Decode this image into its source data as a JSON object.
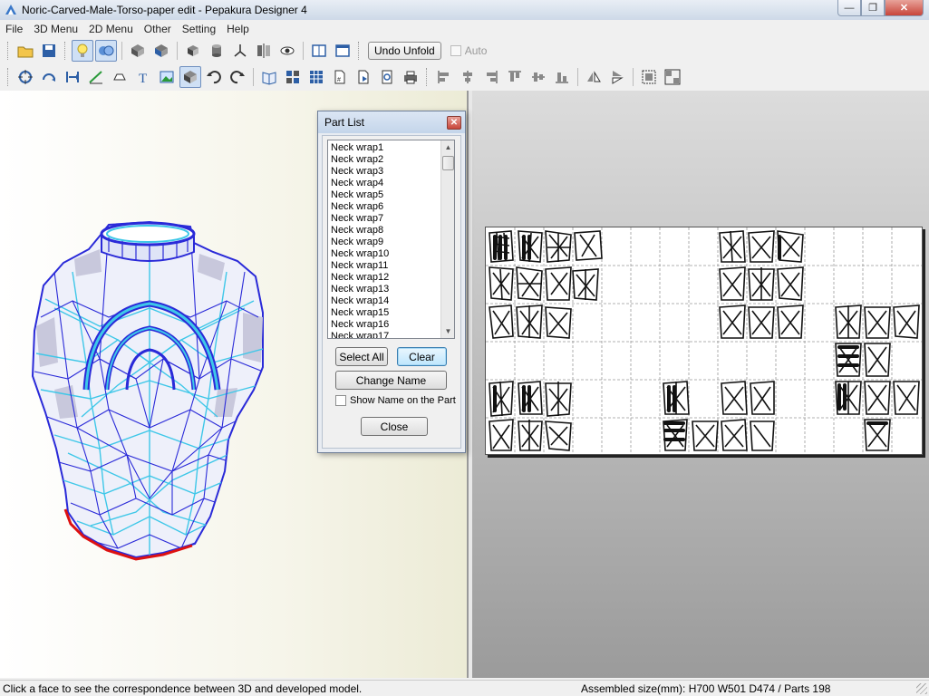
{
  "window": {
    "title": "Noric-Carved-Male-Torso-paper edit - Pepakura Designer 4",
    "controls": {
      "minimize": "—",
      "maximize": "❐",
      "close": "✕"
    }
  },
  "menu": [
    "File",
    "3D Menu",
    "2D Menu",
    "Other",
    "Setting",
    "Help"
  ],
  "toolbar": {
    "undo_unfold_label": "Undo Unfold",
    "auto_label": "Auto",
    "row1_icons": [
      "open-folder-icon",
      "save-icon",
      "lightbulb-icon",
      "texture-icon",
      "cube-rotate-icon",
      "cube-select-icon",
      "cube-icon",
      "cylinder-icon",
      "axes-icon",
      "mirror-icon",
      "eye-icon",
      "single-pane-icon",
      "window-icon"
    ],
    "row2_icons": [
      "rotate-icon",
      "unfold-icon",
      "join-icon",
      "edge-icon",
      "tab-icon",
      "text-icon",
      "image-icon",
      "select-3d-icon",
      "undo-icon",
      "redo-icon",
      "book-icon",
      "arrange-icon",
      "grid-icon",
      "page-icon",
      "export-icon",
      "print-preview-icon",
      "print-icon",
      "align-left-icon",
      "align-center-icon",
      "align-right-icon",
      "align-top-icon",
      "align-middle-icon",
      "align-bottom-icon",
      "flip-h-icon",
      "flip-v-icon",
      "group-icon",
      "ungroup-icon"
    ]
  },
  "part_list": {
    "title": "Part List",
    "close": "✕",
    "items": [
      "Neck wrap1",
      "Neck wrap2",
      "Neck wrap3",
      "Neck wrap4",
      "Neck wrap5",
      "Neck wrap6",
      "Neck wrap7",
      "Neck wrap8",
      "Neck wrap9",
      "Neck wrap10",
      "Neck wrap11",
      "Neck wrap12",
      "Neck wrap13",
      "Neck wrap14",
      "Neck wrap15",
      "Neck wrap16",
      "Neck wrap17"
    ],
    "select_all_label": "Select All",
    "clear_label": "Clear",
    "change_name_label": "Change Name",
    "show_name_label": "Show Name on the Part",
    "show_name_checked": false,
    "close_label": "Close"
  },
  "status": {
    "hint": "Click a face to see the correspondence between 3D and developed model.",
    "assembled": "Assembled size(mm): H700 W501 D474 / Parts 198"
  },
  "colors": {
    "model_edge": "#2a2ad8",
    "model_fold": "#3ec7e8",
    "model_cut": "#dd1111",
    "model_face": "#c8c8dc"
  }
}
